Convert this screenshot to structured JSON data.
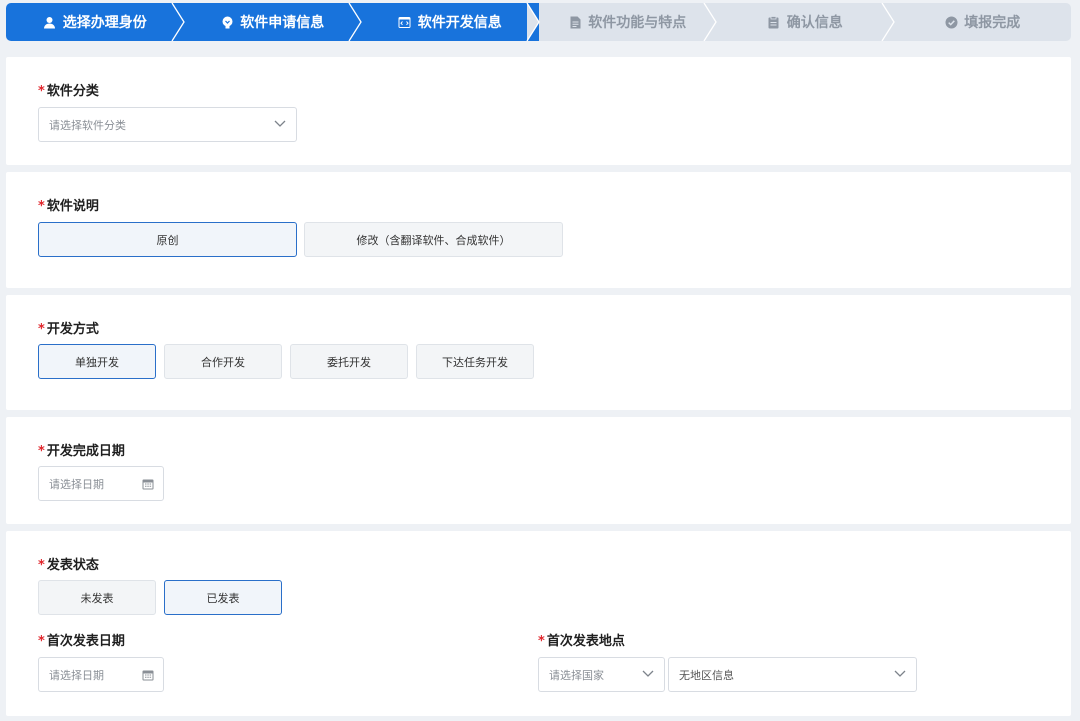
{
  "steps": [
    {
      "label": "选择办理身份",
      "icon": "user-icon",
      "state": "done"
    },
    {
      "label": "软件申请信息",
      "icon": "lightbulb-icon",
      "state": "done"
    },
    {
      "label": "软件开发信息",
      "icon": "code-window-icon",
      "state": "current"
    },
    {
      "label": "软件功能与特点",
      "icon": "document-icon",
      "state": "todo"
    },
    {
      "label": "确认信息",
      "icon": "clipboard-icon",
      "state": "todo"
    },
    {
      "label": "填报完成",
      "icon": "check-circle-icon",
      "state": "todo"
    }
  ],
  "required_mark": "*",
  "category": {
    "label": "软件分类",
    "placeholder": "请选择软件分类"
  },
  "description": {
    "label": "软件说明",
    "options": [
      "原创",
      "修改（含翻译软件、合成软件）"
    ],
    "selected": "原创"
  },
  "dev_method": {
    "label": "开发方式",
    "options": [
      "单独开发",
      "合作开发",
      "委托开发",
      "下达任务开发"
    ],
    "selected": "单独开发"
  },
  "completion_date": {
    "label": "开发完成日期",
    "placeholder": "请选择日期"
  },
  "publish_status": {
    "label": "发表状态",
    "options": [
      "未发表",
      "已发表"
    ],
    "selected": "已发表"
  },
  "first_publish_date": {
    "label": "首次发表日期",
    "placeholder": "请选择日期"
  },
  "first_publish_place": {
    "label": "首次发表地点",
    "country_placeholder": "请选择国家",
    "region_value": "无地区信息"
  },
  "colors": {
    "primary": "#1873dc",
    "step_todo_bg": "#dde3eb",
    "required": "#e0252b",
    "selected_border": "#2a6fc9"
  }
}
